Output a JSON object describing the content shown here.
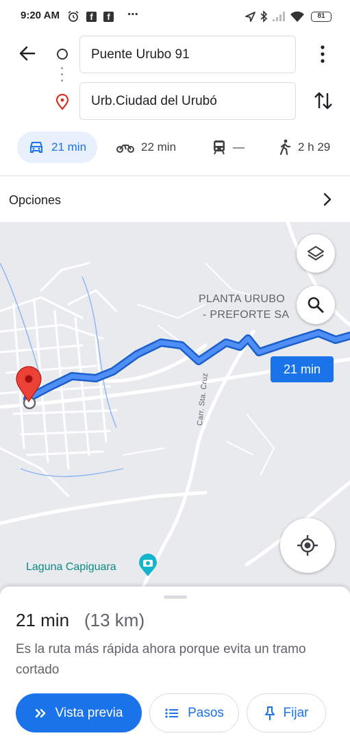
{
  "status_bar": {
    "time": "9:20 AM",
    "more": "⋯",
    "battery": "81",
    "fb_1": "f",
    "fb_2": "f",
    "icons": [
      "alarm-icon",
      "facebook-icon",
      "facebook-icon",
      "location-arrow-icon",
      "bluetooth-icon",
      "signal-icon",
      "wifi-icon",
      "battery-icon"
    ]
  },
  "directions": {
    "origin": "Puente Urubo 91",
    "destination": "Urb.Ciudad del Urubó"
  },
  "modes": [
    {
      "icon": "car-icon",
      "label": "21 min",
      "active": true
    },
    {
      "icon": "motorcycle-icon",
      "label": "22 min",
      "active": false
    },
    {
      "icon": "transit-icon",
      "label": "—",
      "active": false
    },
    {
      "icon": "walking-icon",
      "label": "2 h 29",
      "active": false
    }
  ],
  "options": {
    "label": "Opciones"
  },
  "map": {
    "place_label_line1": "PLANTA URUBO",
    "place_label_line2": "- PREFORTE SA",
    "road_label": "Carr. Sta. Cruz",
    "poi_label": "Laguna Capiguara",
    "route_duration": "21 min",
    "colors": {
      "route": "#4285f4",
      "route_outline": "#1a5fc9",
      "pin": "#ea4335",
      "background": "#e8eaed"
    }
  },
  "sheet": {
    "duration": "21 min",
    "distance": "(13 km)",
    "reason": "Es la ruta más rápida ahora porque evita un tramo cortado",
    "preview_label": "Vista previa",
    "steps_label": "Pasos",
    "pin_label": "Fijar"
  },
  "accent": "#1a73e8"
}
